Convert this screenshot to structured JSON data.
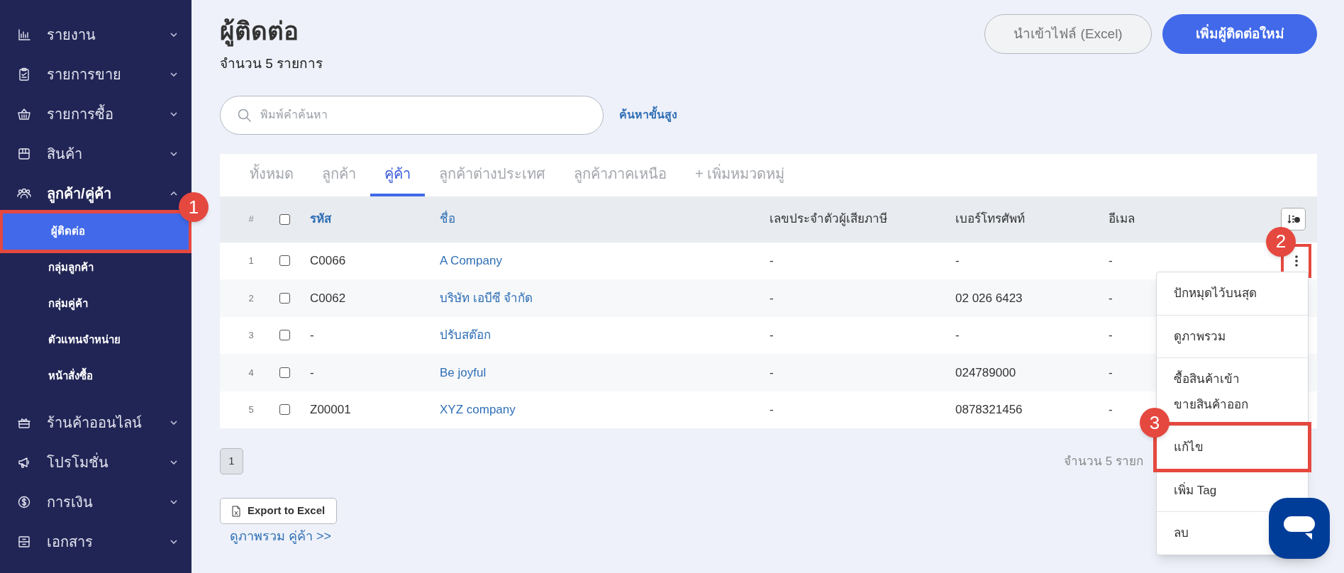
{
  "sidebar": {
    "items": [
      {
        "label": "รายงาน",
        "expanded": false
      },
      {
        "label": "รายการขาย",
        "expanded": false
      },
      {
        "label": "รายการซื้อ",
        "expanded": false
      },
      {
        "label": "สินค้า",
        "expanded": false
      },
      {
        "label": "ลูกค้า/คู่ค้า",
        "expanded": true,
        "children": [
          {
            "label": "ผู้ติดต่อ",
            "selected": true,
            "callout": "1"
          },
          {
            "label": "กลุ่มลูกค้า",
            "selected": false
          },
          {
            "label": "กลุ่มคู่ค้า",
            "selected": false
          },
          {
            "label": "ตัวแทนจำหน่าย",
            "selected": false
          },
          {
            "label": "หน้าสั่งซื้อ",
            "selected": false
          }
        ]
      },
      {
        "label": "ร้านค้าออนไลน์",
        "expanded": false
      },
      {
        "label": "โปรโมชั่น",
        "expanded": false
      },
      {
        "label": "การเงิน",
        "expanded": false
      },
      {
        "label": "เอกสาร",
        "expanded": false
      }
    ]
  },
  "header": {
    "title": "ผู้ติดต่อ",
    "count": "จำนวน 5 รายการ",
    "buttons": [
      {
        "label": "นำเข้าไฟล์ (Excel)",
        "kind": "secondary"
      },
      {
        "label": "เพิ่มผู้ติดต่อใหม่",
        "kind": "primary"
      }
    ]
  },
  "search": {
    "placeholder": "พิมพ์คำค้นหา",
    "advanced_link": "ค้นหาขั้นสูง"
  },
  "tabs": [
    {
      "label": "ทั้งหมด",
      "selected": false
    },
    {
      "label": "ลูกค้า",
      "selected": false
    },
    {
      "label": "คู่ค้า",
      "selected": true
    },
    {
      "label": "ลูกค้าต่างประเทศ",
      "selected": false
    },
    {
      "label": "ลูกค้าภาคเหนือ",
      "selected": false
    },
    {
      "label": "+ เพิ่มหมวดหมู่",
      "selected": false
    }
  ],
  "table": {
    "columns": [
      "#",
      "รหัส",
      "ชื่อ",
      "เลขประจำตัวผู้เสียภาษี",
      "เบอร์โทรศัพท์",
      "อีเมล"
    ],
    "all_checked": false,
    "rows": [
      {
        "index": "1",
        "checked": false,
        "code": "C0066",
        "name": "A Company",
        "tax_id": "-",
        "phone": "-",
        "email": "-",
        "menu_open": true,
        "callout": "2"
      },
      {
        "index": "2",
        "checked": false,
        "code": "C0062",
        "name": "บริษัท เอบีซี จำกัด",
        "tax_id": "-",
        "phone": "02 026 6423",
        "email": "-",
        "menu_open": false
      },
      {
        "index": "3",
        "checked": false,
        "code": "-",
        "name": "ปรับสต๊อก",
        "tax_id": "-",
        "phone": "-",
        "email": "-",
        "menu_open": false
      },
      {
        "index": "4",
        "checked": false,
        "code": "-",
        "name": "Be joyful",
        "tax_id": "-",
        "phone": "024789000",
        "email": "-",
        "menu_open": false
      },
      {
        "index": "5",
        "checked": false,
        "code": "Z00001",
        "name": "XYZ company",
        "tax_id": "-",
        "phone": "0878321456",
        "email": "-",
        "menu_open": false
      }
    ]
  },
  "row_menu": {
    "groups": [
      [
        "ปักหมุดไว้บนสุด"
      ],
      [
        "ดูภาพรวม"
      ],
      [
        "ซื้อสินค้าเข้า",
        "ขายสินค้าออก"
      ],
      [
        {
          "label": "แก้ไข",
          "callout": "3"
        }
      ],
      [
        "เพิ่ม Tag"
      ],
      [
        "ลบ"
      ]
    ]
  },
  "pagination": {
    "pages": [
      {
        "label": "1",
        "selected": true
      }
    ],
    "summary": "จำนวน 5 รายก"
  },
  "export_button": "Export to Excel",
  "overview_link": "ดูภาพรวม คู่ค้า >>"
}
